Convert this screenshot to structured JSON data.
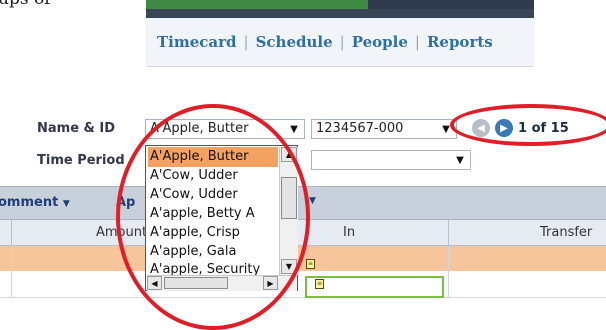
{
  "doc_fragment": "ups of",
  "nav": {
    "items": [
      "Timecard",
      "Schedule",
      "People",
      "Reports"
    ],
    "separator": "|"
  },
  "form": {
    "name_id_label": "Name & ID",
    "name_value": "A'Apple, Butter",
    "id_value": "1234567-000",
    "time_period_label": "Time Period",
    "pager_text": "1 of 15",
    "prev_icon": "arrow-left-icon",
    "next_icon": "arrow-right-icon"
  },
  "toolbar": {
    "comment_label": "omment",
    "approve_partial": "Ap"
  },
  "table": {
    "col_amount": "Amount",
    "col_in": "In",
    "col_transfer": "Transfer"
  },
  "dropdown": {
    "items": [
      "A'Apple, Butter",
      "A'Cow, Udder",
      "A'Cow, Udder",
      "A'apple, Betty A",
      "A'apple, Crisp",
      "A'apple, Gala",
      "A'apple, Security"
    ],
    "selected_index": 0
  },
  "colors": {
    "annotation": "#e11d27",
    "selected_item": "#f4a261",
    "highlight_row": "#f7c59b",
    "nav_link": "#2f6fa6"
  }
}
